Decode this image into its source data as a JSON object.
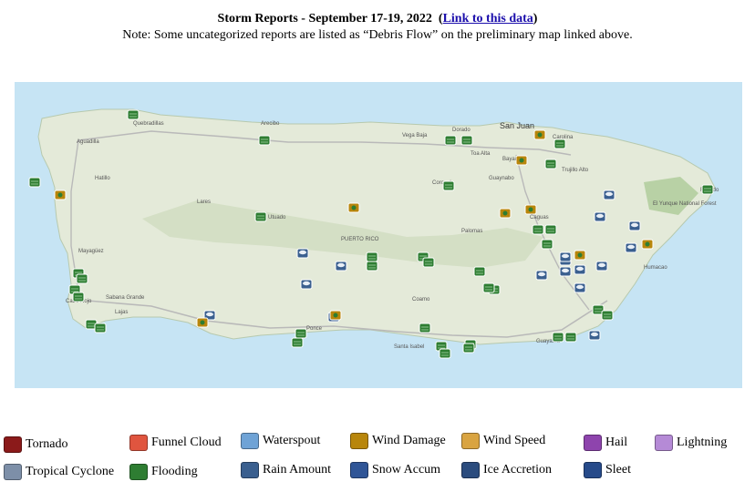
{
  "header": {
    "title": "Storm Reports - September 17-19, 2022",
    "link_text": "Link to this data",
    "note": "Note: Some uncategorized reports are listed as “Debris Flow” on the preliminary map linked above."
  },
  "map": {
    "labels": [
      {
        "text": "San Juan",
        "big": true
      },
      {
        "text": "Carolina"
      },
      {
        "text": "Bayamón"
      },
      {
        "text": "Trujillo Alto"
      },
      {
        "text": "Guaynabo"
      },
      {
        "text": "Dorado"
      },
      {
        "text": "Vega Baja"
      },
      {
        "text": "Arecibo"
      },
      {
        "text": "Quebradillas"
      },
      {
        "text": "Aguadilla"
      },
      {
        "text": "Hatillo"
      },
      {
        "text": "Mayagüez"
      },
      {
        "text": "Sabana Grande"
      },
      {
        "text": "Lajas"
      },
      {
        "text": "Cabo Rojo"
      },
      {
        "text": "Utuado"
      },
      {
        "text": "Lares"
      },
      {
        "text": "PUERTO RICO"
      },
      {
        "text": "Coamo"
      },
      {
        "text": "Santa Isabel"
      },
      {
        "text": "Guayama"
      },
      {
        "text": "Humacao"
      },
      {
        "text": "Caguas"
      },
      {
        "text": "Ponce"
      },
      {
        "text": "Corozal"
      },
      {
        "text": "Fajardo"
      },
      {
        "text": "Palomas"
      },
      {
        "text": "Toa Alta"
      },
      {
        "text": "El Yunque National Forest"
      }
    ],
    "markers": [
      {
        "type": "flooding"
      },
      {
        "type": "flooding"
      },
      {
        "type": "flooding"
      },
      {
        "type": "flooding"
      },
      {
        "type": "flooding"
      },
      {
        "type": "wind_damage"
      },
      {
        "type": "flooding"
      },
      {
        "type": "wind_damage"
      },
      {
        "type": "wind_damage"
      },
      {
        "type": "flooding"
      },
      {
        "type": "flooding"
      },
      {
        "type": "flooding"
      },
      {
        "type": "wind_damage"
      },
      {
        "type": "wind_damage"
      },
      {
        "type": "flooding"
      },
      {
        "type": "wind_damage"
      },
      {
        "type": "rain_amount"
      },
      {
        "type": "rain_amount"
      },
      {
        "type": "rain_amount"
      },
      {
        "type": "flooding"
      },
      {
        "type": "flooding"
      },
      {
        "type": "flooding"
      },
      {
        "type": "wind_damage"
      },
      {
        "type": "wind_damage"
      },
      {
        "type": "rain_amount"
      },
      {
        "type": "rain_amount"
      },
      {
        "type": "flooding"
      },
      {
        "type": "rain_amount"
      },
      {
        "type": "rain_amount"
      },
      {
        "type": "flooding"
      },
      {
        "type": "flooding"
      },
      {
        "type": "flooding"
      },
      {
        "type": "flooding"
      },
      {
        "type": "flooding"
      },
      {
        "type": "flooding"
      },
      {
        "type": "flooding"
      },
      {
        "type": "flooding"
      },
      {
        "type": "flooding"
      },
      {
        "type": "rain_amount"
      },
      {
        "type": "flooding"
      },
      {
        "type": "flooding"
      },
      {
        "type": "flooding"
      },
      {
        "type": "flooding"
      },
      {
        "type": "rain_amount"
      },
      {
        "type": "rain_amount"
      },
      {
        "type": "rain_amount"
      },
      {
        "type": "rain_amount"
      },
      {
        "type": "rain_amount"
      },
      {
        "type": "rain_amount"
      },
      {
        "type": "rain_amount"
      },
      {
        "type": "rain_amount"
      },
      {
        "type": "flooding"
      },
      {
        "type": "flooding"
      },
      {
        "type": "flooding"
      },
      {
        "type": "flooding"
      },
      {
        "type": "flooding"
      },
      {
        "type": "flooding"
      },
      {
        "type": "flooding"
      },
      {
        "type": "wind_damage"
      },
      {
        "type": "flooding"
      },
      {
        "type": "rain_amount"
      },
      {
        "type": "wind_damage"
      },
      {
        "type": "flooding"
      },
      {
        "type": "flooding"
      }
    ]
  },
  "legend": [
    {
      "label": "Tornado",
      "icon": "tornado-icon",
      "color": "#8b1a1a"
    },
    {
      "label": "Funnel Cloud",
      "icon": "funnel-cloud-icon",
      "color": "#e0553f"
    },
    {
      "label": "Waterspout",
      "icon": "waterspout-icon",
      "color": "#6fa3d6"
    },
    {
      "label": "Wind Damage",
      "icon": "wind-damage-icon",
      "color": "#b8860b"
    },
    {
      "label": "Wind Speed",
      "icon": "wind-speed-icon",
      "color": "#d9a441"
    },
    {
      "label": "Hail",
      "icon": "hail-icon",
      "color": "#8e44ad"
    },
    {
      "label": "Lightning",
      "icon": "lightning-icon",
      "color": "#b58ad6"
    },
    {
      "label": "Tropical Cyclone",
      "icon": "tropical-cyclone-icon",
      "color": "#7d8fa8"
    },
    {
      "label": "Flooding",
      "icon": "flooding-icon",
      "color": "#2e7d32"
    },
    {
      "label": "Rain Amount",
      "icon": "rain-amount-icon",
      "color": "#3a5f8f"
    },
    {
      "label": "Snow Accum",
      "icon": "snow-accum-icon",
      "color": "#2f5597"
    },
    {
      "label": "Ice Accretion",
      "icon": "ice-accretion-icon",
      "color": "#2b4c7e"
    },
    {
      "label": "Sleet",
      "icon": "sleet-icon",
      "color": "#264a8a"
    }
  ],
  "colors": {
    "flooding": "#2e7d32",
    "wind_damage": "#b8860b",
    "rain_amount": "#3a5f8f",
    "water": "#c6e4f4",
    "land": "#e4ead9"
  }
}
